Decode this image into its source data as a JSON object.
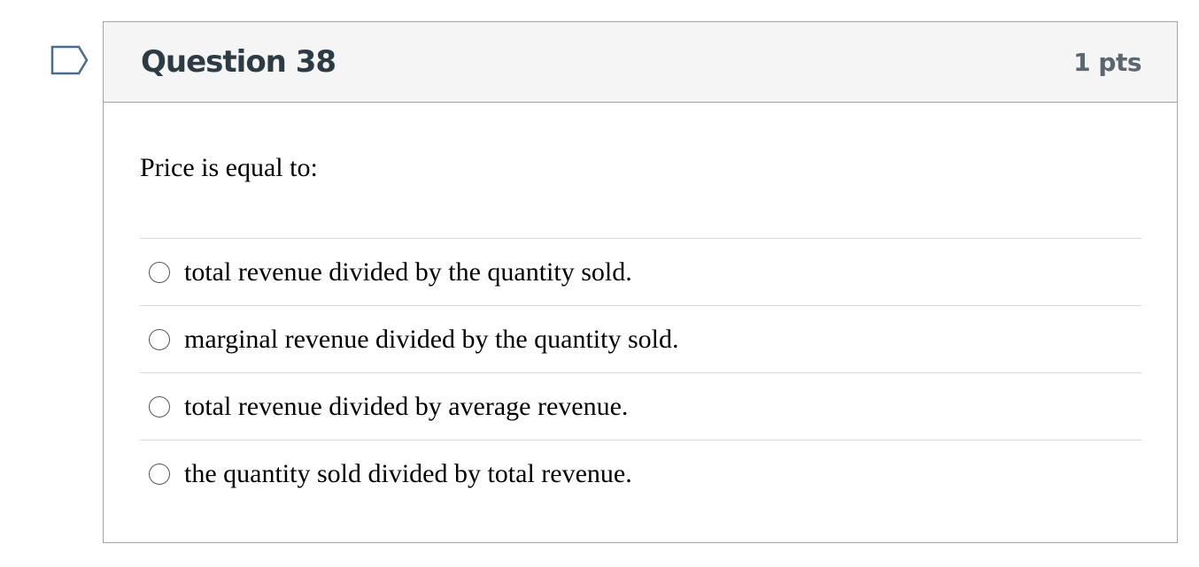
{
  "flag": {
    "icon": "flag-outline-icon",
    "color": "#4a6b8c"
  },
  "question": {
    "title": "Question 38",
    "points": "1 pts",
    "prompt": "Price is equal to:",
    "answers": [
      {
        "label": "total revenue divided by the quantity sold.",
        "selected": false
      },
      {
        "label": "marginal revenue divided by the quantity sold.",
        "selected": false
      },
      {
        "label": "total revenue divided by average revenue.",
        "selected": false
      },
      {
        "label": "the quantity sold divided by total revenue.",
        "selected": false
      }
    ]
  },
  "colors": {
    "header_background": "#f5f5f5",
    "border": "#a5a5a5",
    "title": "#2d3b45",
    "points": "#5b6770"
  }
}
